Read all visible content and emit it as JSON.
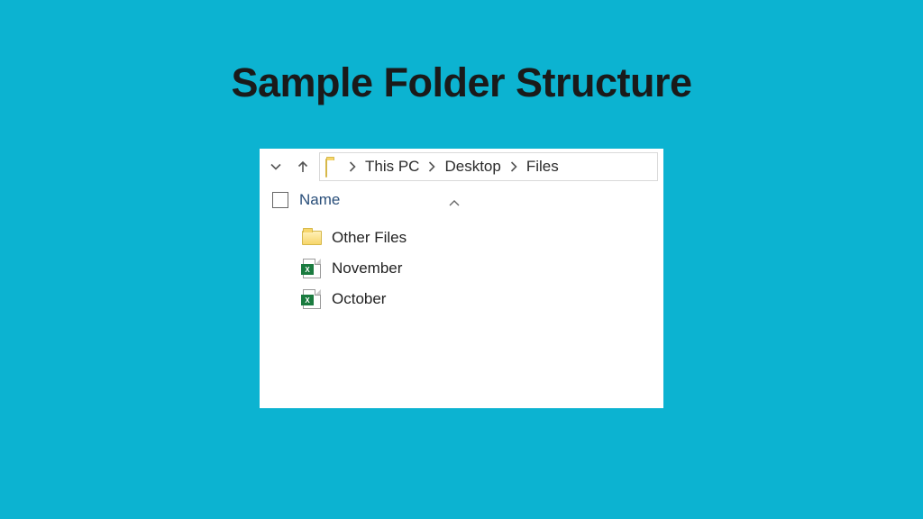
{
  "slide": {
    "title": "Sample Folder Structure"
  },
  "explorer": {
    "breadcrumb": [
      "This PC",
      "Desktop",
      "Files"
    ],
    "columns": {
      "name": "Name"
    },
    "items": [
      {
        "type": "folder",
        "label": "Other Files"
      },
      {
        "type": "excel",
        "label": "November"
      },
      {
        "type": "excel",
        "label": "October"
      }
    ]
  }
}
